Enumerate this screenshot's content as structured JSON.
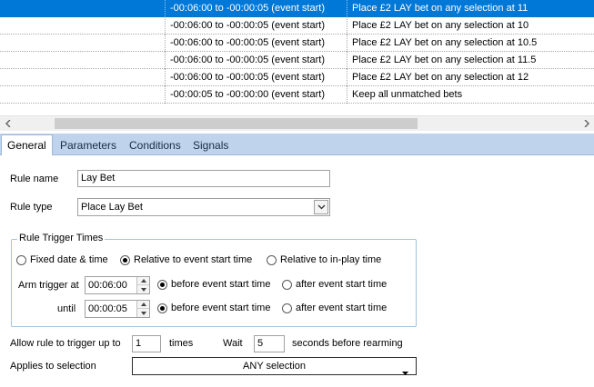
{
  "grid": {
    "rows": [
      {
        "trigger": "-00:06:00 to -00:00:05 (event start)",
        "action": "Place £2 LAY bet on any selection at 11",
        "selected": true
      },
      {
        "trigger": "-00:06:00 to -00:00:05 (event start)",
        "action": "Place £2 LAY bet on any selection at 10",
        "selected": false
      },
      {
        "trigger": "-00:06:00 to -00:00:05 (event start)",
        "action": "Place £2 LAY bet on any selection at 10.5",
        "selected": false
      },
      {
        "trigger": "-00:06:00 to -00:00:05 (event start)",
        "action": "Place £2 LAY bet on any selection at 11.5",
        "selected": false
      },
      {
        "trigger": "-00:06:00 to -00:00:05 (event start)",
        "action": "Place £2 LAY bet on any selection at 12",
        "selected": false
      },
      {
        "trigger": "-00:00:05 to -00:00:00 (event start)",
        "action": "Keep all unmatched bets",
        "selected": false
      }
    ]
  },
  "scrollbar": {
    "left_icon": "scroll-left-arrow-icon",
    "right_icon": "scroll-right-arrow-icon"
  },
  "tabs": {
    "general": "General",
    "parameters": "Parameters",
    "conditions": "Conditions",
    "signals": "Signals",
    "active": "general"
  },
  "form": {
    "rule_name_label": "Rule name",
    "rule_name_value": "Lay Bet",
    "rule_type_label": "Rule type",
    "rule_type_value": "Place Lay Bet",
    "trigger_group_title": "Rule Trigger Times",
    "radio_fixed": "Fixed date & time",
    "radio_relative_start": "Relative to event start time",
    "radio_relative_inplay": "Relative to in-play time",
    "arm_label": "Arm trigger at",
    "arm_value": "00:06:00",
    "arm_before": "before event start time",
    "arm_after": "after event start time",
    "until_label": "until",
    "until_value": "00:00:05",
    "until_before": "before event start time",
    "until_after": "after event start time",
    "allow_label": "Allow rule to trigger up to",
    "allow_value": "1",
    "times_label": "times",
    "wait_label": "Wait",
    "wait_value": "5",
    "seconds_label": "seconds before rearming",
    "applies_label": "Applies to selection",
    "applies_value": "ANY selection"
  },
  "colors": {
    "selection": "#0078d7",
    "tabstrip": "#bfd3ec",
    "groupbox_border": "#a5c3df"
  }
}
